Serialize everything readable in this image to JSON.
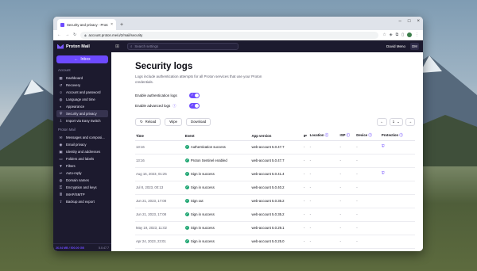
{
  "browser": {
    "tab_title": "Security and privacy - Proton Ac",
    "new_tab": "+",
    "url": "account.proton.me/u/2/mail/security"
  },
  "topbar": {
    "brand": "Proton Mail",
    "search_placeholder": "Search settings",
    "user_name": "David Meno",
    "user_initials": "DM"
  },
  "sidebar": {
    "inbox_label": "Inbox",
    "sections": [
      {
        "heading": "Account",
        "items": [
          {
            "label": "Dashboard",
            "icon": "dashboard-icon",
            "glyph": "▦"
          },
          {
            "label": "Recovery",
            "icon": "recovery-icon",
            "glyph": "↺"
          },
          {
            "label": "Account and password",
            "icon": "user-icon",
            "glyph": "☺"
          },
          {
            "label": "Language and time",
            "icon": "globe-icon",
            "glyph": "◍"
          },
          {
            "label": "Appearance",
            "icon": "palette-icon",
            "glyph": "◐"
          },
          {
            "label": "Security and privacy",
            "icon": "shield-icon",
            "glyph": "⛨",
            "active": true
          },
          {
            "label": "Import via Easy Switch",
            "icon": "import-icon",
            "glyph": "⇩"
          }
        ]
      },
      {
        "heading": "Proton Mail",
        "items": [
          {
            "label": "Messages and composi...",
            "icon": "envelope-icon",
            "glyph": "✉"
          },
          {
            "label": "Email privacy",
            "icon": "eye-icon",
            "glyph": "◉"
          },
          {
            "label": "Identity and addresses",
            "icon": "id-card-icon",
            "glyph": "▣"
          },
          {
            "label": "Folders and labels",
            "icon": "folder-icon",
            "glyph": "▭"
          },
          {
            "label": "Filters",
            "icon": "filter-icon",
            "glyph": "▼"
          },
          {
            "label": "Auto-reply",
            "icon": "reply-icon",
            "glyph": "↩"
          },
          {
            "label": "Domain names",
            "icon": "globe-icon",
            "glyph": "◍"
          },
          {
            "label": "Encryption and keys",
            "icon": "key-icon",
            "glyph": "⚿"
          },
          {
            "label": "IMAP/SMTP",
            "icon": "server-icon",
            "glyph": "≣"
          },
          {
            "label": "Backup and export",
            "icon": "export-icon",
            "glyph": "⇪"
          }
        ]
      }
    ],
    "footer_left": "26.04 MB / 500.00 GB",
    "footer_right": "5.0.47.7"
  },
  "page": {
    "title": "Security logs",
    "description": "Logs include authentication attempts for all Proton services that use your Proton credentials.",
    "toggle_auth_label": "Enable authentication logs",
    "toggle_advanced_label": "Enable advanced logs",
    "reload": "Reload",
    "wipe": "Wipe",
    "download": "Download",
    "page_num": "1"
  },
  "table": {
    "headers": [
      "Time",
      "Event",
      "App version",
      "IP",
      "Location",
      "ISP",
      "Device",
      "Protection"
    ],
    "rows": [
      {
        "time": "13:16",
        "event": "Authentication success",
        "app": "web-account 5.0.47.7",
        "ip": "-",
        "location": "-",
        "isp": "-",
        "device": "-",
        "protection": true
      },
      {
        "time": "13:16",
        "event": "Proton Sentinel enabled",
        "app": "web-account 5.0.47.7",
        "ip": "-",
        "location": "-",
        "isp": "-",
        "device": "-",
        "protection": false
      },
      {
        "time": "Aug 16, 2023, 01:25",
        "event": "Sign in success",
        "app": "web-account 5.0.41.4",
        "ip": "-",
        "location": "-",
        "isp": "-",
        "device": "-",
        "protection": true
      },
      {
        "time": "Jul 8, 2023, 00:13",
        "event": "Sign in success",
        "app": "web-account 5.0.40.2",
        "ip": "-",
        "location": "-",
        "isp": "-",
        "device": "-",
        "protection": false
      },
      {
        "time": "Jun 21, 2023, 17:08",
        "event": "Sign out",
        "app": "web-account 5.0.35.2",
        "ip": "-",
        "location": "-",
        "isp": "-",
        "device": "-",
        "protection": false
      },
      {
        "time": "Jun 21, 2023, 17:08",
        "event": "Sign in success",
        "app": "web-account 5.0.35.2",
        "ip": "-",
        "location": "-",
        "isp": "-",
        "device": "-",
        "protection": false
      },
      {
        "time": "May 19, 2023, 11:02",
        "event": "Sign in success",
        "app": "web-account 5.0.29.1",
        "ip": "-",
        "location": "-",
        "isp": "-",
        "device": "-",
        "protection": false
      },
      {
        "time": "Apr 24, 2023, 23:01",
        "event": "Sign in success",
        "app": "web-account 5.0.25.0",
        "ip": "-",
        "location": "-",
        "isp": "-",
        "device": "-",
        "protection": false
      }
    ]
  }
}
